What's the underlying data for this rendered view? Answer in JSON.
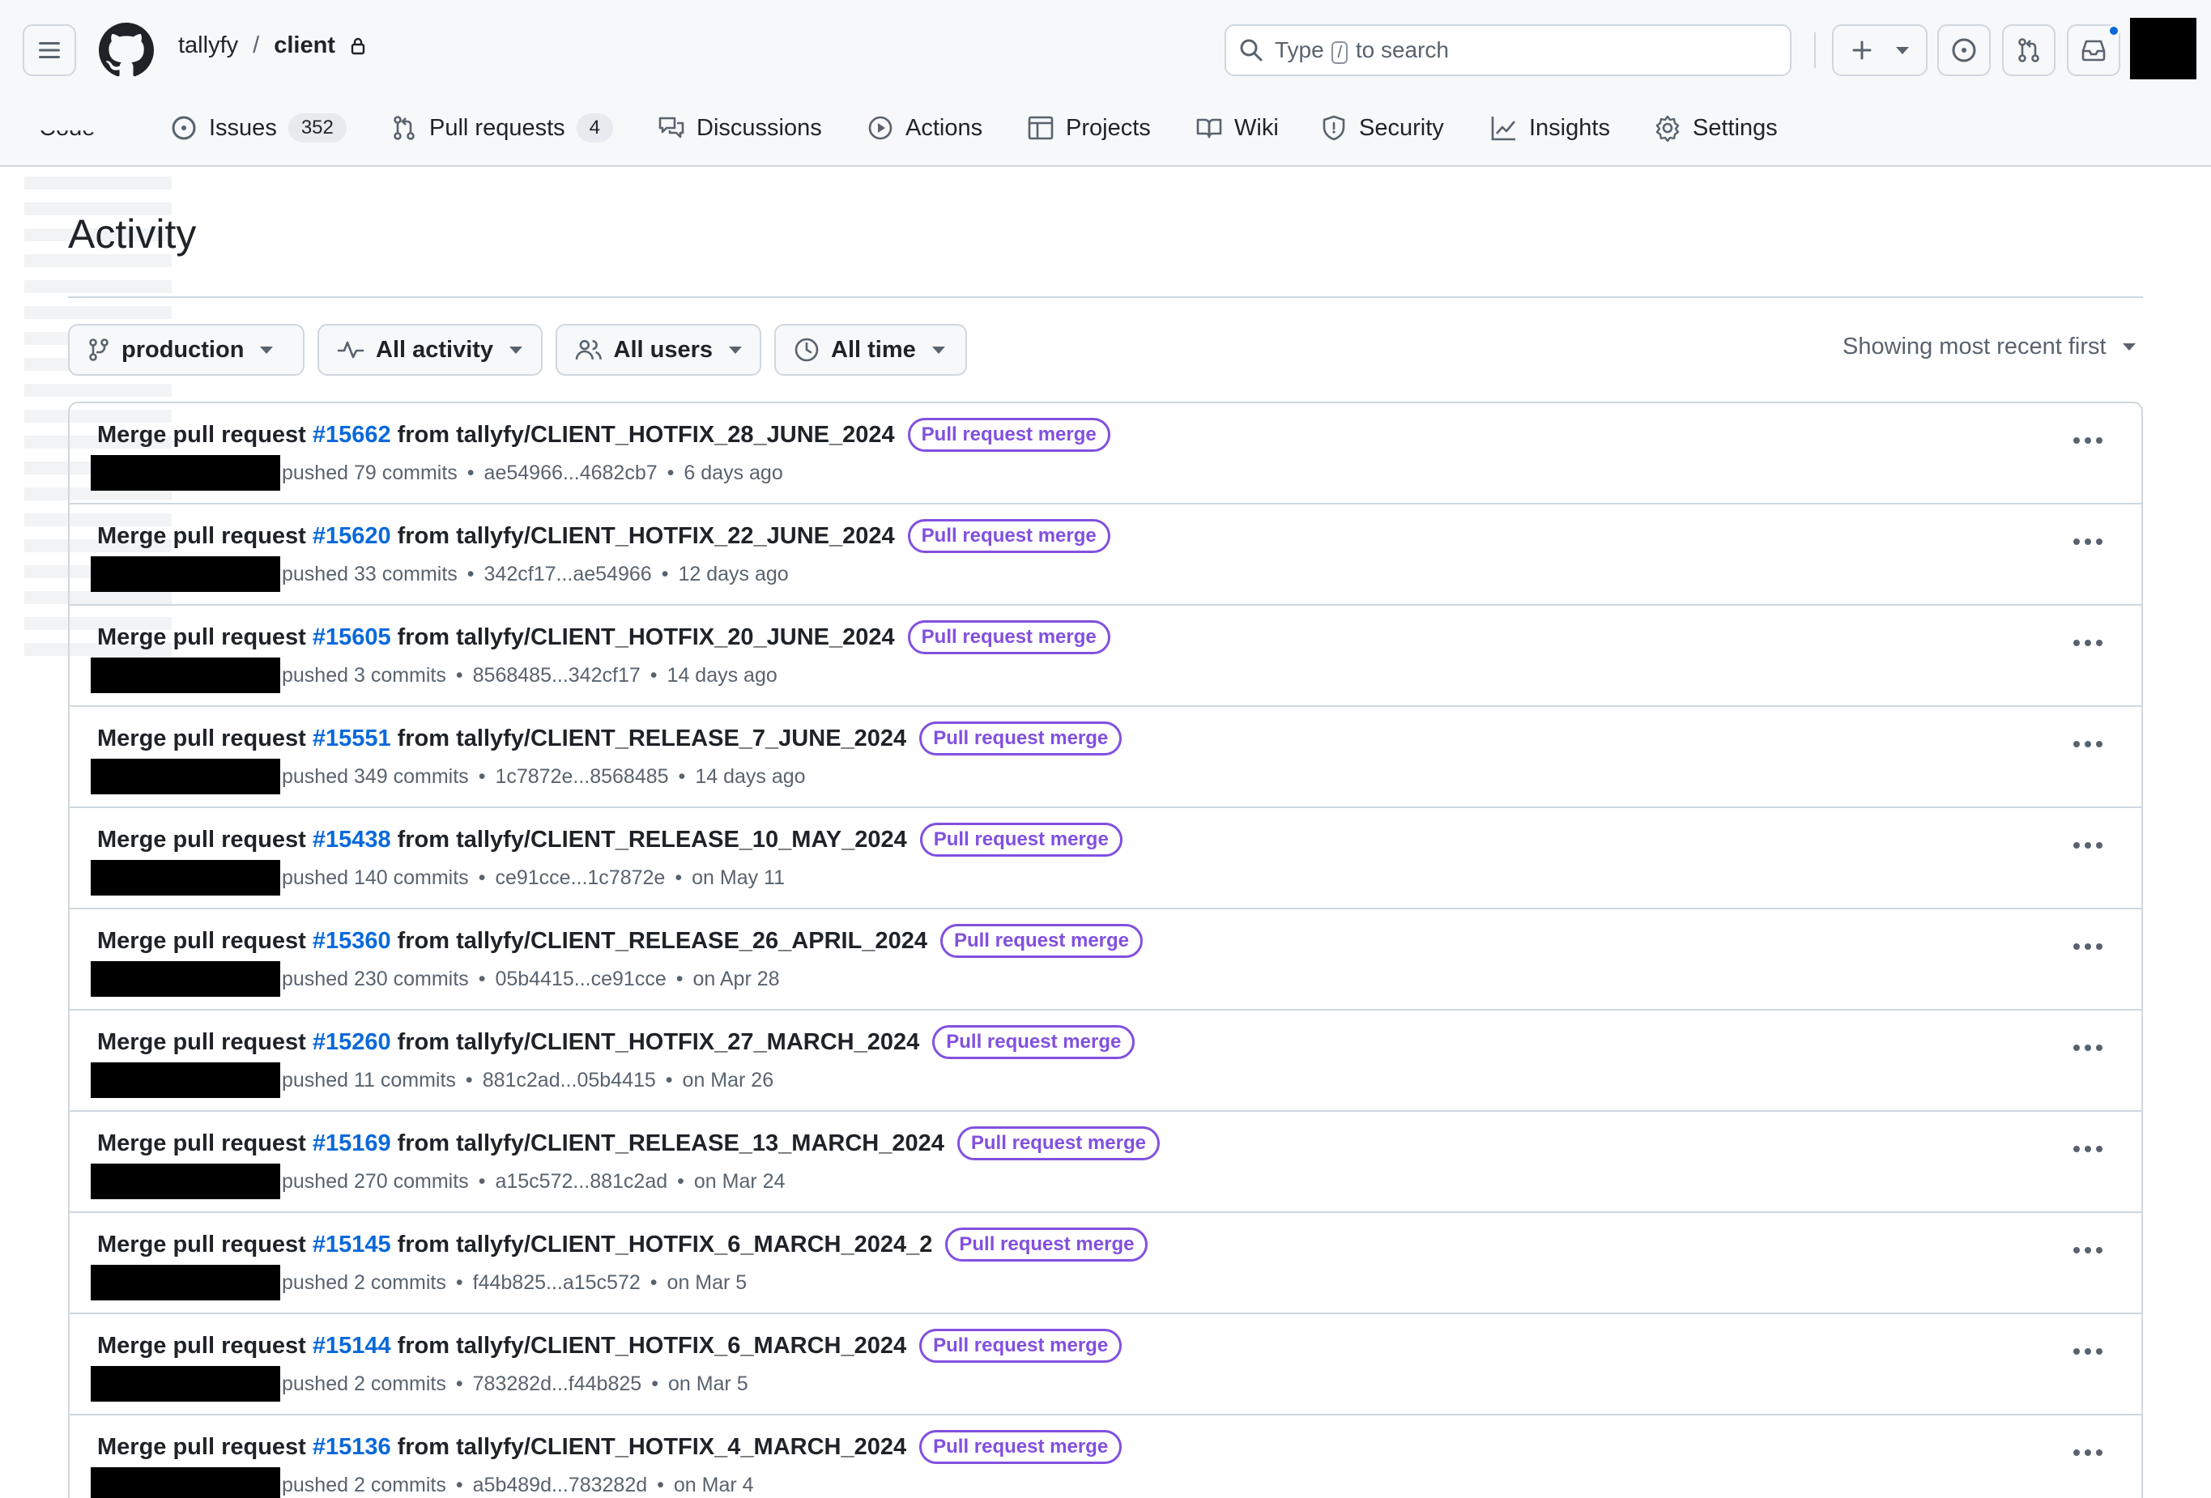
{
  "header": {
    "owner": "tallyfy",
    "separator": "/",
    "repo": "client",
    "search_prefix": "Type",
    "search_key": "/",
    "search_suffix": "to search"
  },
  "nav": {
    "code_partial": "Code",
    "issues": "Issues",
    "issues_count": "352",
    "pull_requests": "Pull requests",
    "pull_requests_count": "4",
    "discussions": "Discussions",
    "actions": "Actions",
    "projects": "Projects",
    "wiki": "Wiki",
    "security": "Security",
    "insights": "Insights",
    "settings": "Settings"
  },
  "page": {
    "title": "Activity",
    "branch_filter": "production",
    "activity_filter": "All activity",
    "users_filter": "All users",
    "time_filter": "All time",
    "sort": "Showing most recent first"
  },
  "rows": [
    {
      "prefix": "Merge pull request",
      "pr": "#15662",
      "branch": "from tallyfy/CLIENT_HOTFIX_28_JUNE_2024",
      "label": "Pull request merge",
      "pushed": "pushed 79 commits",
      "range": "ae54966...4682cb7",
      "when": "6 days ago"
    },
    {
      "prefix": "Merge pull request",
      "pr": "#15620",
      "branch": "from tallyfy/CLIENT_HOTFIX_22_JUNE_2024",
      "label": "Pull request merge",
      "pushed": "pushed 33 commits",
      "range": "342cf17...ae54966",
      "when": "12 days ago"
    },
    {
      "prefix": "Merge pull request",
      "pr": "#15605",
      "branch": "from tallyfy/CLIENT_HOTFIX_20_JUNE_2024",
      "label": "Pull request merge",
      "pushed": "pushed 3 commits",
      "range": "8568485...342cf17",
      "when": "14 days ago"
    },
    {
      "prefix": "Merge pull request",
      "pr": "#15551",
      "branch": "from tallyfy/CLIENT_RELEASE_7_JUNE_2024",
      "label": "Pull request merge",
      "pushed": "pushed 349 commits",
      "range": "1c7872e...8568485",
      "when": "14 days ago"
    },
    {
      "prefix": "Merge pull request",
      "pr": "#15438",
      "branch": "from tallyfy/CLIENT_RELEASE_10_MAY_2024",
      "label": "Pull request merge",
      "pushed": "pushed 140 commits",
      "range": "ce91cce...1c7872e",
      "when": "on May 11"
    },
    {
      "prefix": "Merge pull request",
      "pr": "#15360",
      "branch": "from tallyfy/CLIENT_RELEASE_26_APRIL_2024",
      "label": "Pull request merge",
      "pushed": "pushed 230 commits",
      "range": "05b4415...ce91cce",
      "when": "on Apr 28"
    },
    {
      "prefix": "Merge pull request",
      "pr": "#15260",
      "branch": "from tallyfy/CLIENT_HOTFIX_27_MARCH_2024",
      "label": "Pull request merge",
      "pushed": "pushed 11 commits",
      "range": "881c2ad...05b4415",
      "when": "on Mar 26"
    },
    {
      "prefix": "Merge pull request",
      "pr": "#15169",
      "branch": "from tallyfy/CLIENT_RELEASE_13_MARCH_2024",
      "label": "Pull request merge",
      "pushed": "pushed 270 commits",
      "range": "a15c572...881c2ad",
      "when": "on Mar 24"
    },
    {
      "prefix": "Merge pull request",
      "pr": "#15145",
      "branch": "from tallyfy/CLIENT_HOTFIX_6_MARCH_2024_2",
      "label": "Pull request merge",
      "pushed": "pushed 2 commits",
      "range": "f44b825...a15c572",
      "when": "on Mar 5"
    },
    {
      "prefix": "Merge pull request",
      "pr": "#15144",
      "branch": "from tallyfy/CLIENT_HOTFIX_6_MARCH_2024",
      "label": "Pull request merge",
      "pushed": "pushed 2 commits",
      "range": "783282d...f44b825",
      "when": "on Mar 5"
    },
    {
      "prefix": "Merge pull request",
      "pr": "#15136",
      "branch": "from tallyfy/CLIENT_HOTFIX_4_MARCH_2024",
      "label": "Pull request merge",
      "pushed": "pushed 2 commits",
      "range": "a5b489d...783282d",
      "when": "on Mar 4"
    }
  ]
}
